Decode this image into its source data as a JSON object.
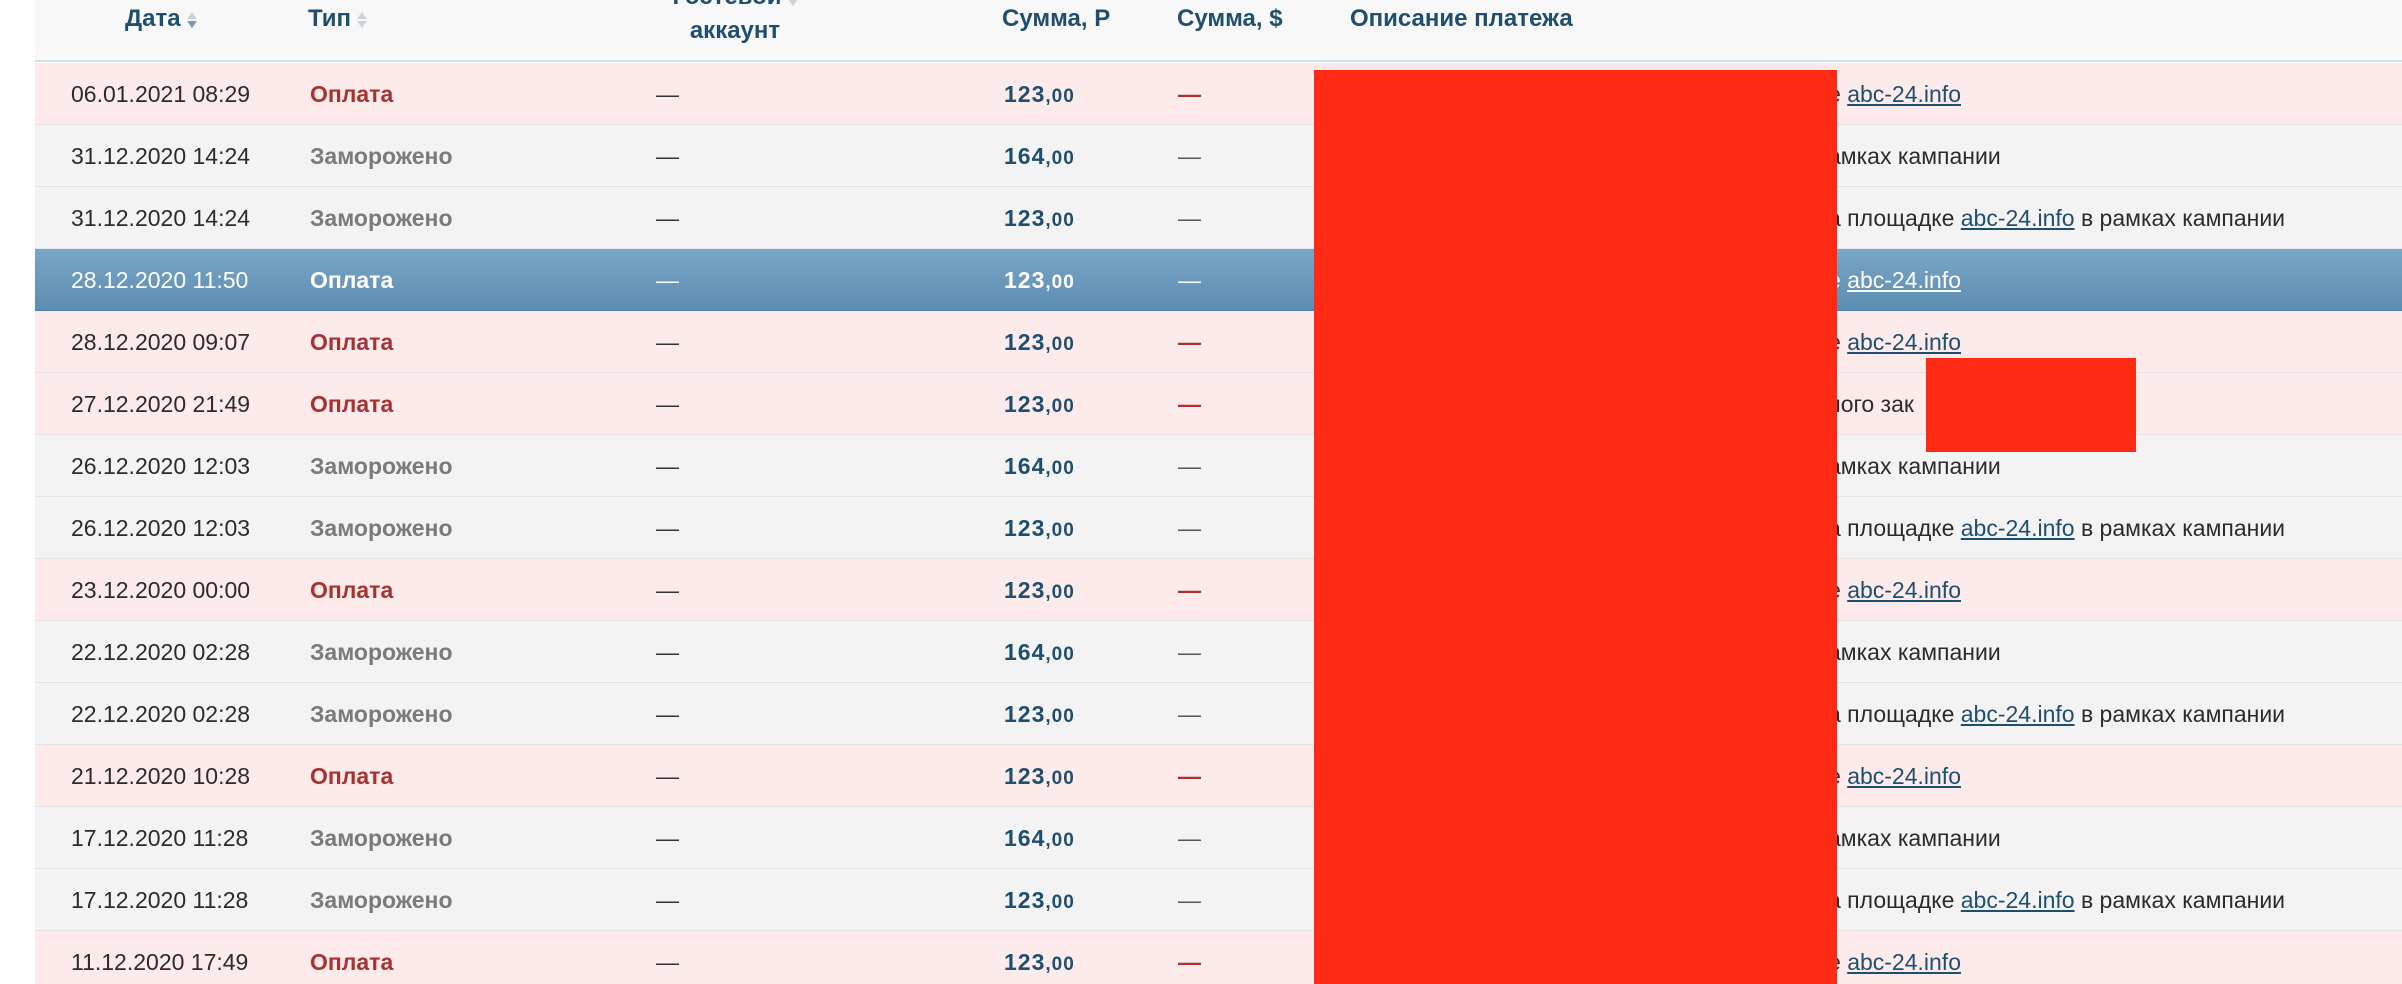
{
  "colors": {
    "header_text": "#1f4f6f",
    "payment_row_bg": "#fdeaea",
    "frozen_row_bg": "#f3f3f3",
    "payment_type_text": "#a83232",
    "frozen_type_text": "#7a7a7a",
    "selected_row_bg": "#5c8db2",
    "redaction": "#ff2a14"
  },
  "table": {
    "headers": {
      "date": "Дата",
      "type": "Тип",
      "guest_line1": "Гостевой",
      "guest_line2": "аккаунт",
      "sum_rub": "Сумма, Р",
      "sum_usd": "Сумма, $",
      "description": "Описание платежа"
    },
    "rows": [
      {
        "date": "06.01.2021 08:29",
        "type": "Оплата",
        "kind": "pay",
        "guest": "—",
        "rub_int": "123",
        "rub_frac": ",00",
        "usd": "—",
        "desc_text": "е ",
        "desc_link": "abc-24.info",
        "desc_after": ""
      },
      {
        "date": "31.12.2020 14:24",
        "type": "Заморожено",
        "kind": "frozen",
        "guest": "—",
        "rub_int": "164",
        "rub_frac": ",00",
        "usd": "—",
        "desc_text": "амках кампании",
        "desc_link": "",
        "desc_after": ""
      },
      {
        "date": "31.12.2020 14:24",
        "type": "Заморожено",
        "kind": "frozen",
        "guest": "—",
        "rub_int": "123",
        "rub_frac": ",00",
        "usd": "—",
        "desc_text": "а площадке ",
        "desc_link": "abc-24.info",
        "desc_after": " в рамках кампании"
      },
      {
        "date": "28.12.2020 11:50",
        "type": "Оплата",
        "kind": "sel",
        "guest": "—",
        "rub_int": "123",
        "rub_frac": ",00",
        "usd": "—",
        "desc_text": "е ",
        "desc_link": "abc-24.info",
        "desc_after": ""
      },
      {
        "date": "28.12.2020 09:07",
        "type": "Оплата",
        "kind": "pay",
        "guest": "—",
        "rub_int": "123",
        "rub_frac": ",00",
        "usd": "—",
        "desc_text": "е ",
        "desc_link": "abc-24.info",
        "desc_after": ""
      },
      {
        "date": "27.12.2020 21:49",
        "type": "Оплата",
        "kind": "pay",
        "guest": "—",
        "rub_int": "123",
        "rub_frac": ",00",
        "usd": "—",
        "desc_text": "ного зак",
        "desc_link": "",
        "desc_after": ""
      },
      {
        "date": "26.12.2020 12:03",
        "type": "Заморожено",
        "kind": "frozen",
        "guest": "—",
        "rub_int": "164",
        "rub_frac": ",00",
        "usd": "—",
        "desc_text": "амках кампании",
        "desc_link": "",
        "desc_after": ""
      },
      {
        "date": "26.12.2020 12:03",
        "type": "Заморожено",
        "kind": "frozen",
        "guest": "—",
        "rub_int": "123",
        "rub_frac": ",00",
        "usd": "—",
        "desc_text": "а площадке ",
        "desc_link": "abc-24.info",
        "desc_after": " в рамках кампании"
      },
      {
        "date": "23.12.2020 00:00",
        "type": "Оплата",
        "kind": "pay",
        "guest": "—",
        "rub_int": "123",
        "rub_frac": ",00",
        "usd": "—",
        "desc_text": "е ",
        "desc_link": "abc-24.info",
        "desc_after": ""
      },
      {
        "date": "22.12.2020 02:28",
        "type": "Заморожено",
        "kind": "frozen",
        "guest": "—",
        "rub_int": "164",
        "rub_frac": ",00",
        "usd": "—",
        "desc_text": "амках кампании",
        "desc_link": "",
        "desc_after": ""
      },
      {
        "date": "22.12.2020 02:28",
        "type": "Заморожено",
        "kind": "frozen",
        "guest": "—",
        "rub_int": "123",
        "rub_frac": ",00",
        "usd": "—",
        "desc_text": "а площадке ",
        "desc_link": "abc-24.info",
        "desc_after": " в рамках кампании"
      },
      {
        "date": "21.12.2020 10:28",
        "type": "Оплата",
        "kind": "pay",
        "guest": "—",
        "rub_int": "123",
        "rub_frac": ",00",
        "usd": "—",
        "desc_text": "е ",
        "desc_link": "abc-24.info",
        "desc_after": ""
      },
      {
        "date": "17.12.2020 11:28",
        "type": "Заморожено",
        "kind": "frozen",
        "guest": "—",
        "rub_int": "164",
        "rub_frac": ",00",
        "usd": "—",
        "desc_text": "амках кампании",
        "desc_link": "",
        "desc_after": ""
      },
      {
        "date": "17.12.2020 11:28",
        "type": "Заморожено",
        "kind": "frozen",
        "guest": "—",
        "rub_int": "123",
        "rub_frac": ",00",
        "usd": "—",
        "desc_text": "а площадке ",
        "desc_link": "abc-24.info",
        "desc_after": " в рамках кампании"
      },
      {
        "date": "11.12.2020 17:49",
        "type": "Оплата",
        "kind": "pay",
        "guest": "—",
        "rub_int": "123",
        "rub_frac": ",00",
        "usd": "—",
        "desc_text": "е ",
        "desc_link": "abc-24.info",
        "desc_after": ""
      }
    ]
  }
}
